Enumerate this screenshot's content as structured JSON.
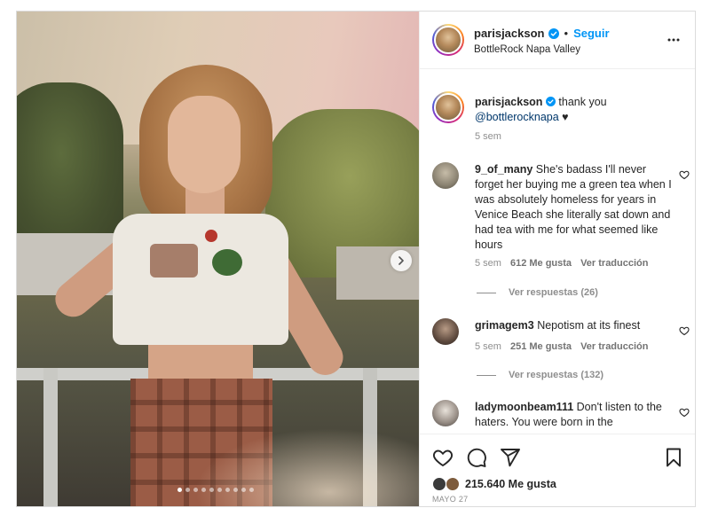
{
  "post": {
    "username": "parisjackson",
    "follow_label": "Seguir",
    "separator": "•",
    "location": "BottleRock Napa Valley",
    "caption_user": "parisjackson",
    "caption_text": "thank you",
    "caption_mention": "@bottlerocknapa",
    "caption_suffix": " ♥",
    "caption_age": "5 sem",
    "carousel": {
      "total_slides": 10,
      "active_index": 1
    },
    "likes": "215.640 Me gusta",
    "date": "MAYO 27"
  },
  "comments": [
    {
      "user": "9_of_many",
      "text": "She's badass I'll never forget her buying me a green tea when I was absolutely homeless for years in Venice Beach she literally sat down and had tea with me for what seemed like hours",
      "age": "5 sem",
      "likes": "612 Me gusta",
      "translate": "Ver traducción",
      "replies": "Ver respuestas (26)"
    },
    {
      "user": "grimagem3",
      "text": "Nepotism at its finest",
      "age": "5 sem",
      "likes": "251 Me gusta",
      "translate": "Ver traducción",
      "replies": "Ver respuestas (132)"
    },
    {
      "user": "ladymoonbeam111",
      "text": "Don't listen to the haters. You were born in the",
      "age": "",
      "likes": "",
      "translate": "",
      "replies": ""
    }
  ],
  "colors": {
    "follow_blue": "#0095f6",
    "verified_blue": "#0095f6",
    "mention_blue": "#00376b",
    "muted_text": "#8e8e8e"
  },
  "icons": [
    "heart-icon",
    "comment-icon",
    "share-icon",
    "bookmark-icon",
    "more-options-icon",
    "verified-badge-icon",
    "chevron-right-icon"
  ]
}
